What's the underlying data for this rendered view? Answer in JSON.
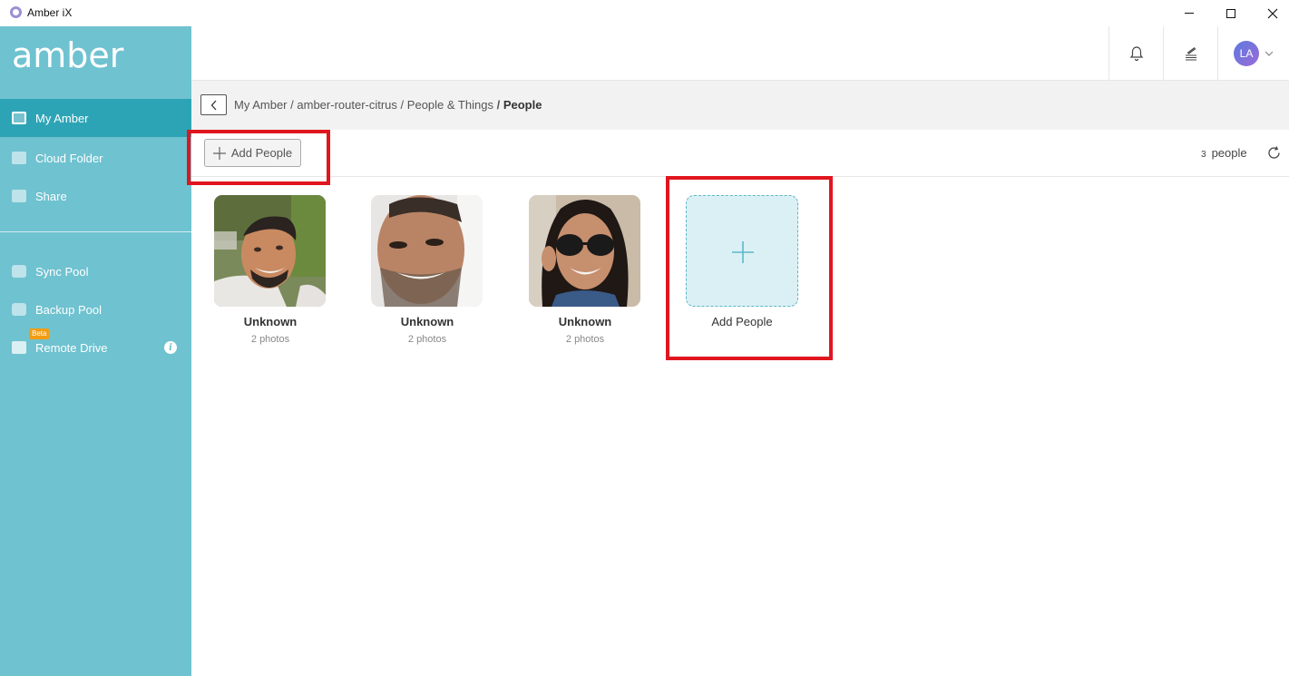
{
  "window": {
    "title": "Amber iX"
  },
  "sidebar": {
    "logo": "amber",
    "items": [
      {
        "label": "My Amber",
        "icon": "book-icon",
        "active": true
      },
      {
        "label": "Cloud Folder",
        "icon": "folder-icon"
      },
      {
        "label": "Share",
        "icon": "share-icon"
      },
      {
        "label": "Sync Pool",
        "icon": "sync-icon"
      },
      {
        "label": "Backup Pool",
        "icon": "backup-icon"
      },
      {
        "label": "Remote Drive",
        "icon": "remote-drive-icon",
        "badge": "Beta"
      }
    ],
    "info_glyph": "i"
  },
  "header": {
    "avatar_initials": "LA"
  },
  "breadcrumb": {
    "items": [
      "My Amber",
      "amber-router-citrus",
      "People & Things"
    ],
    "separator": "/",
    "current": "People"
  },
  "toolbar": {
    "add_label": "Add People",
    "count": "3",
    "count_unit": "people"
  },
  "people": [
    {
      "name": "Unknown",
      "photos": "2 photos"
    },
    {
      "name": "Unknown",
      "photos": "2 photos"
    },
    {
      "name": "Unknown",
      "photos": "2 photos"
    }
  ],
  "add_card": {
    "label": "Add People"
  },
  "colors": {
    "sidebar": "#6fc2d0",
    "sidebar_active": "#2da4b5",
    "highlight": "#e0161e",
    "add_card_bg": "#dbf0f4"
  }
}
